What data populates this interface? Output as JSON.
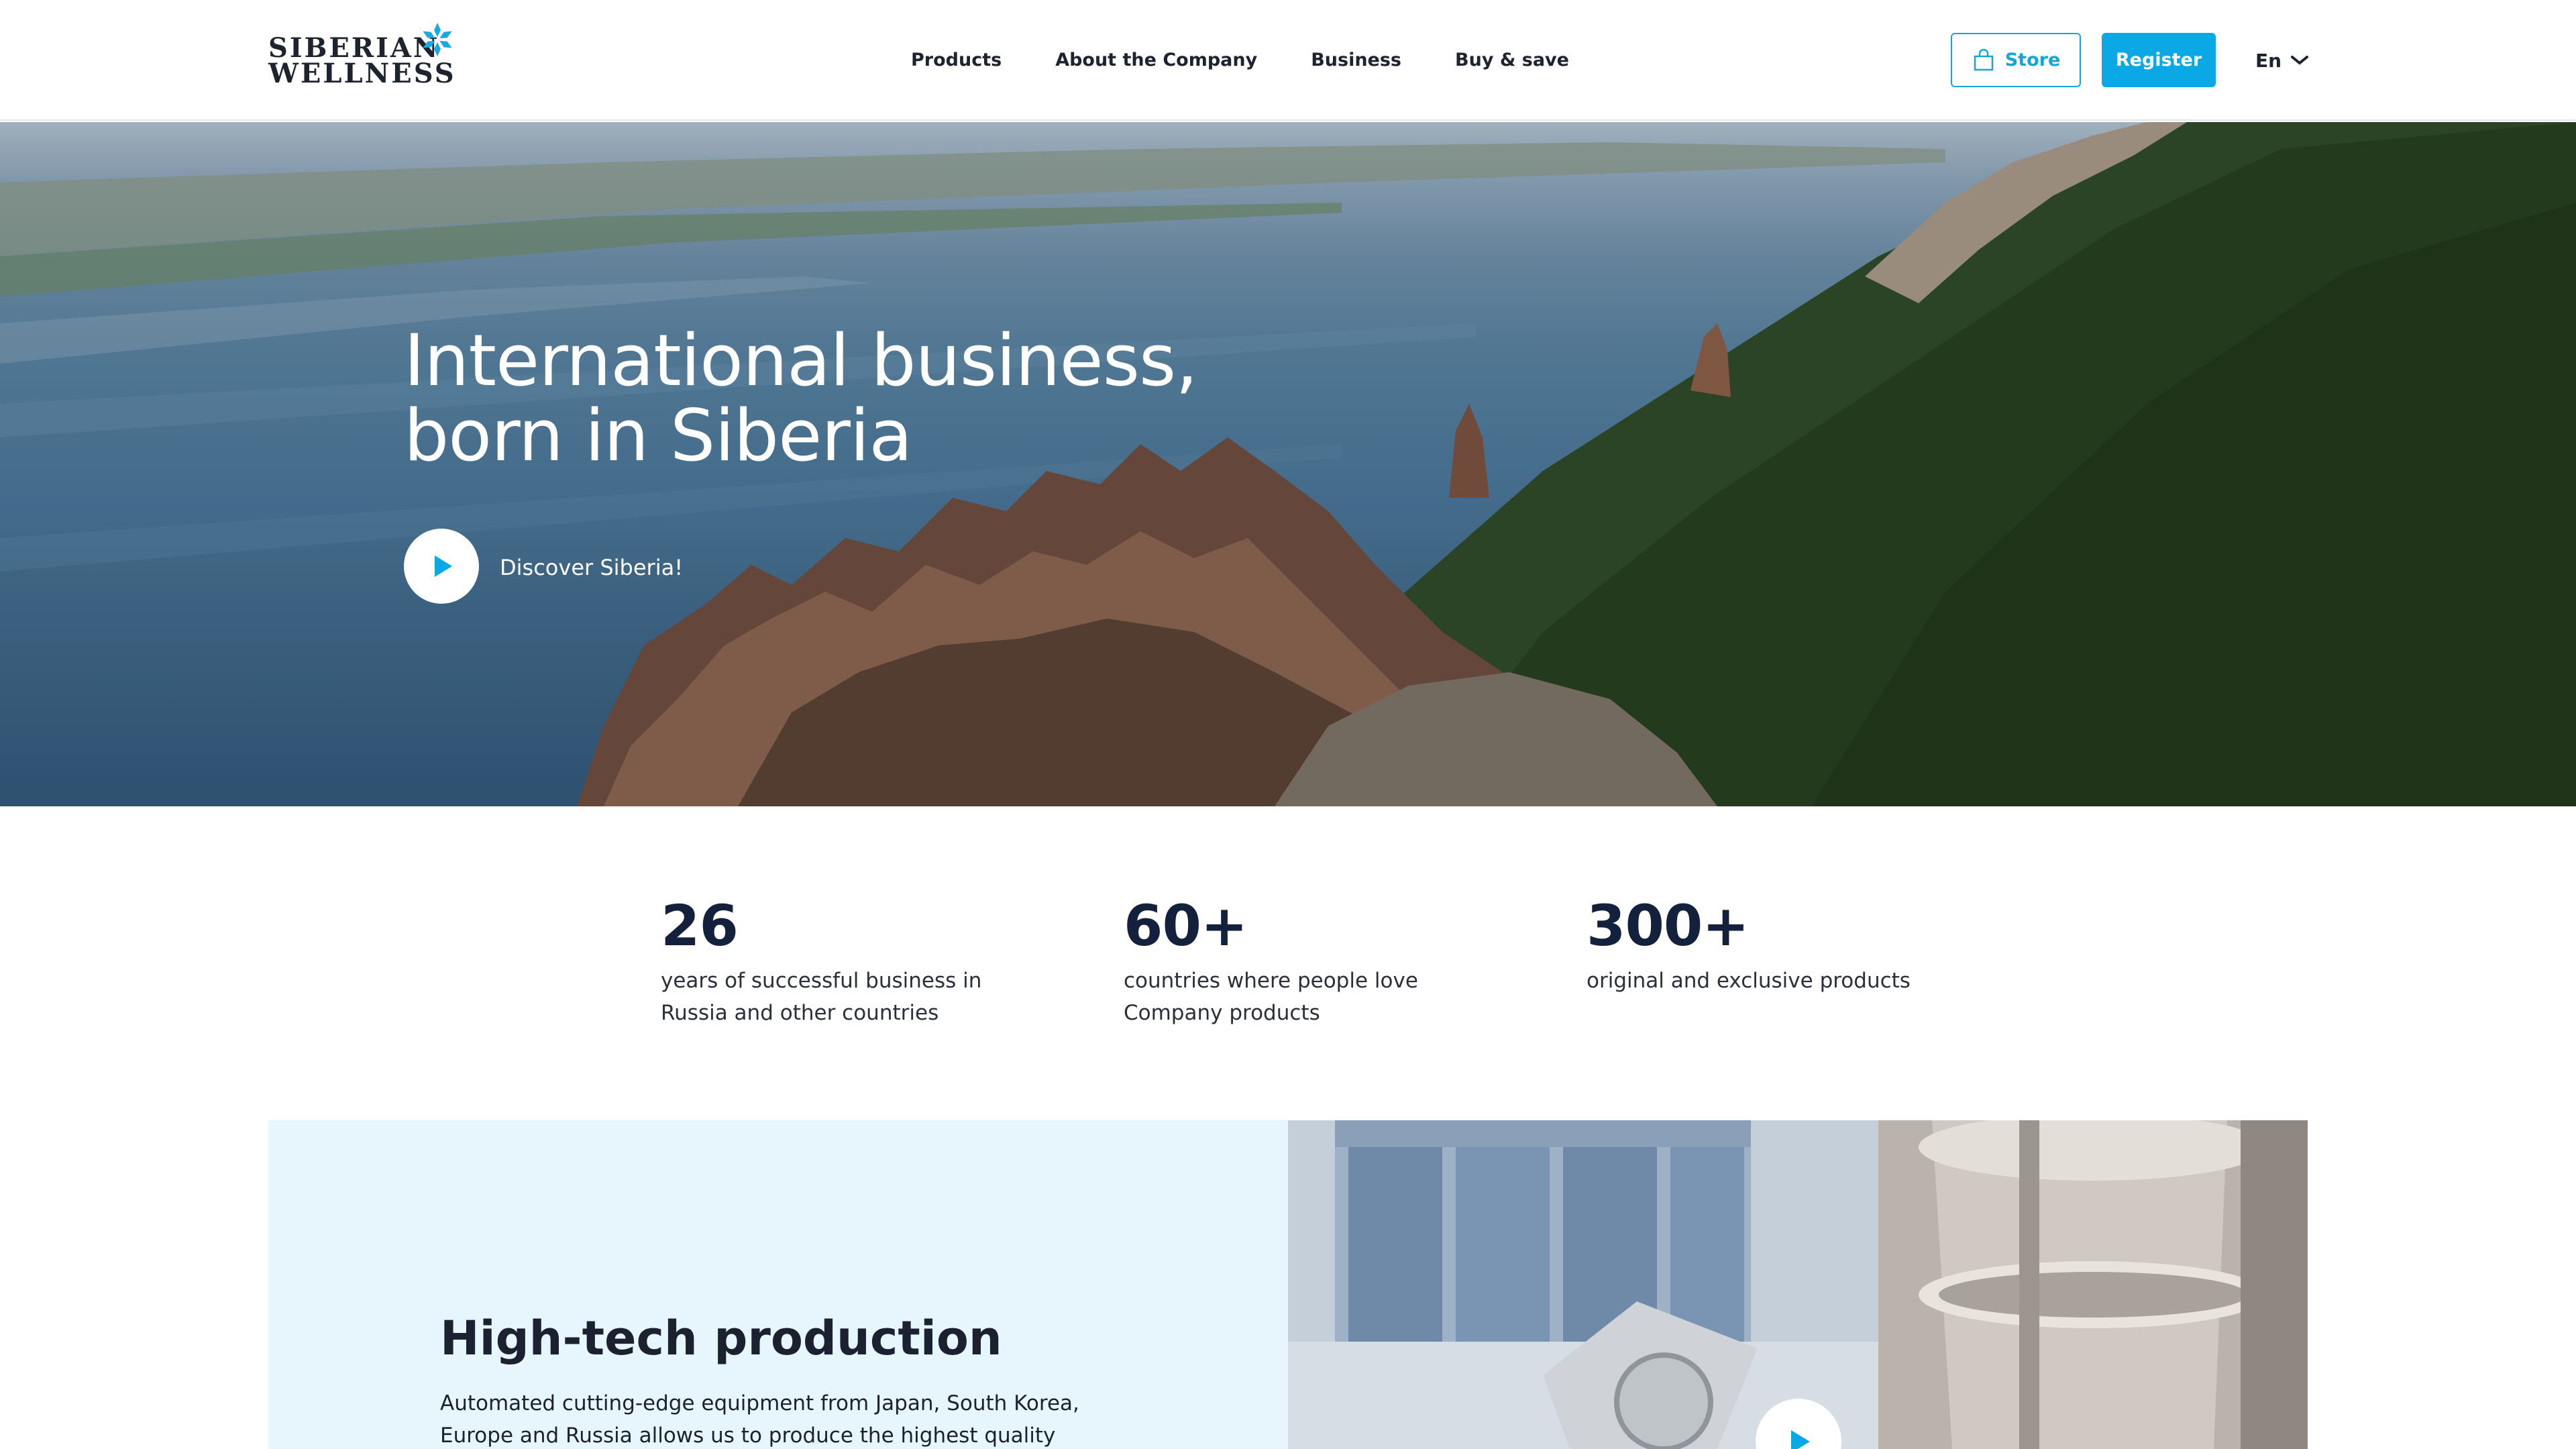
{
  "brand": {
    "logo_line1": "SIBERIAN",
    "logo_line2": "WELLNESS",
    "accent_color": "#0aa8e4"
  },
  "nav": {
    "items": [
      {
        "label": "Products"
      },
      {
        "label": "About the Company"
      },
      {
        "label": "Business"
      },
      {
        "label": "Buy & save"
      }
    ]
  },
  "header_actions": {
    "store_label": "Store",
    "store_icon": "shopping-bag-icon",
    "register_label": "Register",
    "language": "En",
    "language_icon": "chevron-down-icon"
  },
  "hero": {
    "title": "International business, born in Siberia",
    "video_label": "Discover Siberia!",
    "play_icon": "play-icon"
  },
  "stats": [
    {
      "value": "26",
      "description": "years of successful business in Russia and other countries"
    },
    {
      "value": "60+",
      "description": "countries where people love Company products"
    },
    {
      "value": "300+",
      "description": "original and exclusive products"
    }
  ],
  "feature": {
    "title": "High-tech production",
    "description": "Automated cutting-edge equipment from Japan, South Korea, Europe and Russia allows us to produce the highest quality products in the",
    "play_icon": "play-icon"
  }
}
